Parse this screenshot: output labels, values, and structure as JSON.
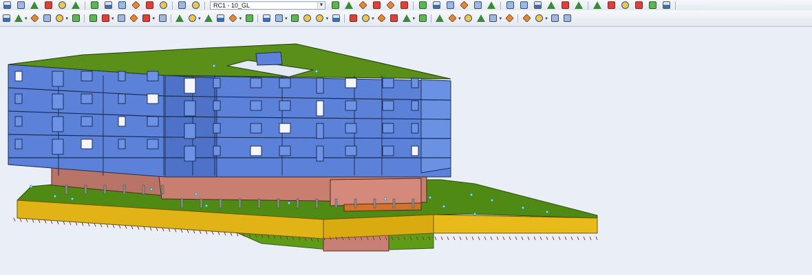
{
  "toolbar_top": {
    "left_icons": [
      "open-icon",
      "folder-icon",
      "database-icon",
      "save-icon",
      "print-icon",
      "export-icon",
      "undo-icon",
      "redo-icon",
      "pencil-icon",
      "search-icon",
      "zoom-icon",
      "frame-icon",
      "document-icon",
      "window-icon"
    ],
    "view_combo": {
      "value": "RC1 - 10_GL"
    },
    "right_icons": [
      "previous-icon",
      "next-icon",
      "result-icon",
      "deformation-icon",
      "diagram-icon",
      "table-icon",
      "list-icon",
      "grid-icon",
      "stress-icon",
      "member-icon",
      "support-icon",
      "calculate-icon",
      "settings-icon",
      "check-icon",
      "info-icon",
      "link-icon",
      "warning-icon",
      "error-icon",
      "ok-icon",
      "notes-icon",
      "plugin-icon",
      "render-icon",
      "chart-icon",
      "print-report-icon"
    ]
  },
  "toolbar_bottom": {
    "icons": [
      "node-icon",
      "line-icon",
      "member-icon",
      "surface-icon",
      "solid-icon",
      "opening-icon",
      "load-icon",
      "filter-icon",
      "select-icon",
      "rotate-icon",
      "move-icon",
      "copy-icon",
      "mirror-icon",
      "divide-icon",
      "section-icon",
      "view-iso-icon",
      "view-x-icon",
      "view-y-icon",
      "view-z-icon",
      "zoom-all-icon",
      "zoom-window-icon",
      "pan-icon",
      "display-icon",
      "render-solid-icon",
      "render-wire-icon",
      "transparency-icon",
      "axes-icon",
      "dimension-icon",
      "comment-icon",
      "guide-icon",
      "clipping-icon",
      "visibility-icon",
      "color-icon",
      "legend-icon",
      "support-view-icon",
      "hinge-icon",
      "grid-view-icon",
      "snap-icon",
      "measure-icon",
      "color-scale-icon"
    ]
  },
  "viewport": {
    "colors": {
      "background": "#eaeff7",
      "facade": "#5b82d8",
      "facade_dark": "#3e5da8",
      "roof": "#5a8f1a",
      "ground_floor": "#c97f70",
      "slab_yellow": "#e1b316",
      "ground_green": "#4f8a14",
      "support": "#7d3a1f"
    }
  }
}
